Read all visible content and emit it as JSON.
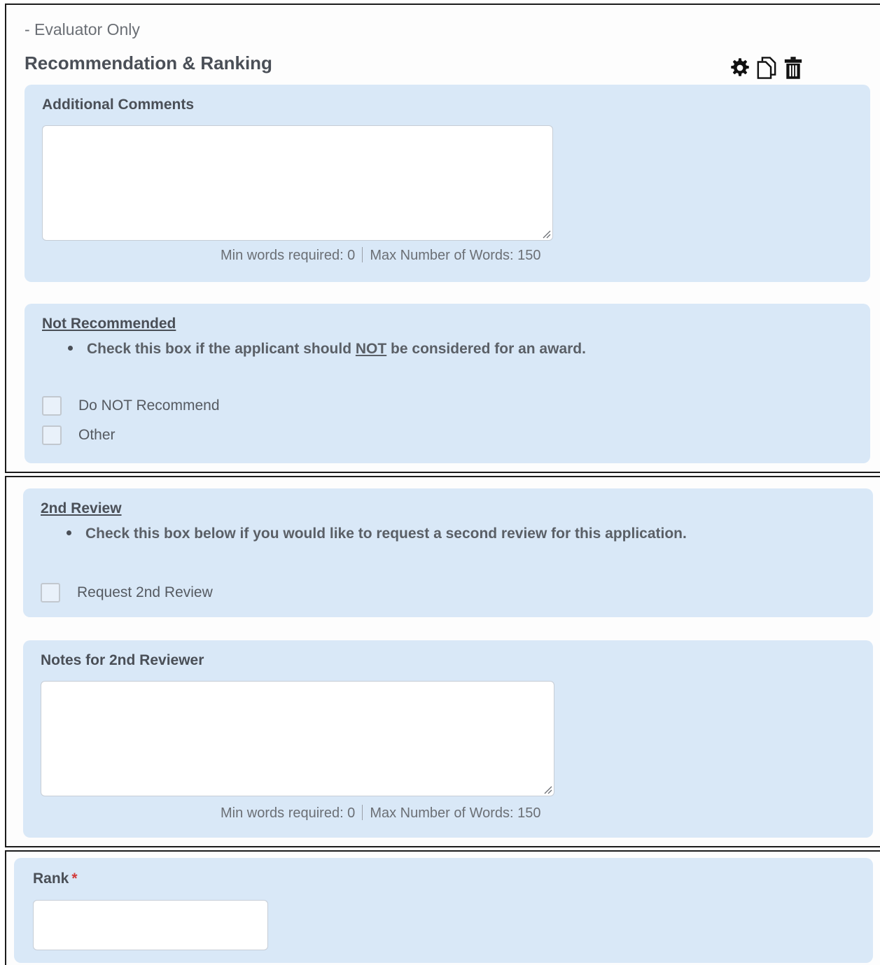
{
  "header": {
    "evaluator_only": "- Evaluator Only",
    "title": "Recommendation & Ranking",
    "icons": [
      "gear-icon",
      "copy-icon",
      "trash-icon"
    ]
  },
  "additional_comments": {
    "label": "Additional Comments",
    "value": "",
    "min_words": "Min words required: 0",
    "max_words": "Max Number of Words: 150"
  },
  "not_recommended": {
    "label": "Not Recommended",
    "instruction_pre": "Check this box if the applicant should ",
    "instruction_emph": "NOT",
    "instruction_post": " be considered for an award.",
    "options": [
      "Do NOT Recommend",
      "Other"
    ]
  },
  "second_review": {
    "label": "2nd Review",
    "instruction": "Check this box below if you would like to request a second review for this application.",
    "option": "Request 2nd Review"
  },
  "notes_second_reviewer": {
    "label": "Notes for 2nd Reviewer",
    "value": "",
    "min_words": "Min words required: 0",
    "max_words": "Max Number of Words: 150"
  },
  "rank": {
    "label": "Rank",
    "required_mark": "*",
    "value": ""
  },
  "colors": {
    "panel": "#d9e8f7",
    "frame_border": "#1b1b1b",
    "required": "#d23b3b"
  }
}
